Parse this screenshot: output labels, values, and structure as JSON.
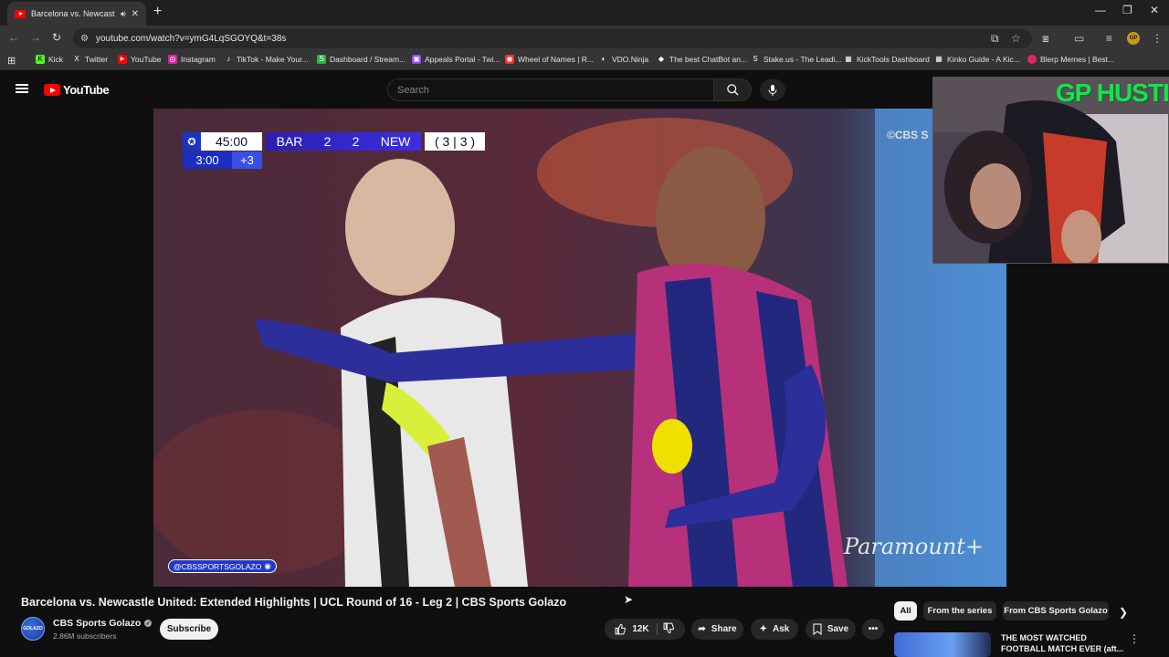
{
  "browser": {
    "tab": {
      "title": "Barcelona vs. Newcastle Uni",
      "audio_icon": "speaker-icon"
    },
    "url": "youtube.com/watch?v=ymG4LqSGOYQ&t=38s",
    "bookmarks": [
      {
        "label": "Kick",
        "color": "#53fc18",
        "glyph": "K"
      },
      {
        "label": "Twitter",
        "color": "#000000",
        "glyph": "X"
      },
      {
        "label": "YouTube",
        "color": "#ff0000",
        "glyph": "▶"
      },
      {
        "label": "Instagram",
        "color": "#d6249f",
        "glyph": "◎"
      },
      {
        "label": "TikTok - Make Your...",
        "color": "#111111",
        "glyph": "♪"
      },
      {
        "label": "Dashboard / Stream...",
        "color": "#2fb344",
        "glyph": "S"
      },
      {
        "label": "Appeals Portal - Twi...",
        "color": "#9146ff",
        "glyph": "▣"
      },
      {
        "label": "Wheel of Names | R...",
        "color": "#e33",
        "glyph": "◉"
      },
      {
        "label": "VDO.Ninja",
        "color": "#444",
        "glyph": "◐"
      },
      {
        "label": "The best ChatBot an...",
        "color": "#333",
        "glyph": "◆"
      },
      {
        "label": "Stake.us - The Leadi...",
        "color": "#333",
        "glyph": "S"
      },
      {
        "label": "KickTools Dashboard",
        "color": "#333",
        "glyph": "▦"
      },
      {
        "label": "Kinko Guide - A Kic...",
        "color": "#333",
        "glyph": "▦"
      },
      {
        "label": "Blerp Memes | Best...",
        "color": "#e02560",
        "glyph": "●"
      }
    ]
  },
  "youtube": {
    "logo_text": "YouTube",
    "search_placeholder": "Search"
  },
  "video": {
    "scorebug": {
      "match_time": "45:00",
      "home": "BAR",
      "home_score": "2",
      "away_score": "2",
      "away": "NEW",
      "aggregate": "( 3 | 3 )",
      "added_time": "3:00",
      "added_plus": "+3"
    },
    "broadcaster": "©CBS S",
    "handle": "@CBSSPORTSGOLAZO",
    "paramount": "Paramount+",
    "webcam_overlay_text": "GP HUSTLA",
    "title": "Barcelona vs. Newcastle United: Extended Highlights | UCL Round of 16 - Leg 2 | CBS Sports Golazo"
  },
  "channel": {
    "name": "CBS Sports Golazo",
    "avatar_text": "GOLAZO",
    "subscribers": "2.86M subscribers",
    "subscribe_label": "Subscribe"
  },
  "actions": {
    "likes": "12K",
    "share": "Share",
    "ask": "Ask",
    "save": "Save"
  },
  "chips": [
    "All",
    "From the series",
    "From CBS Sports Golazo"
  ],
  "recommendation": {
    "title": "THE MOST WATCHED FOOTBALL MATCH EVER (aft..."
  },
  "colors": {
    "accent": "#ff0000",
    "background": "#0f0f0f",
    "overlay_green": "#19e24a"
  }
}
